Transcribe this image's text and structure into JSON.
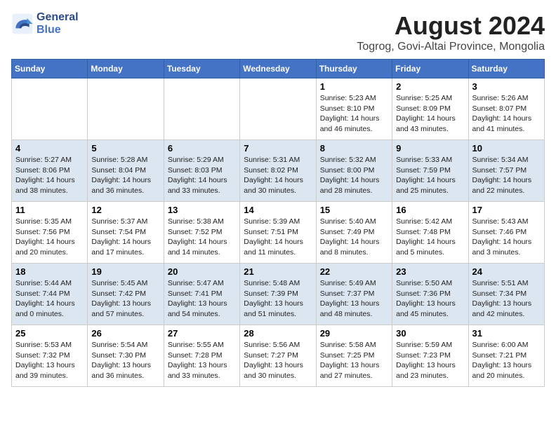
{
  "logo": {
    "line1": "General",
    "line2": "Blue"
  },
  "title": "August 2024",
  "subtitle": "Togrog, Govi-Altai Province, Mongolia",
  "weekdays": [
    "Sunday",
    "Monday",
    "Tuesday",
    "Wednesday",
    "Thursday",
    "Friday",
    "Saturday"
  ],
  "weeks": [
    [
      {
        "day": "",
        "content": ""
      },
      {
        "day": "",
        "content": ""
      },
      {
        "day": "",
        "content": ""
      },
      {
        "day": "",
        "content": ""
      },
      {
        "day": "1",
        "content": "Sunrise: 5:23 AM\nSunset: 8:10 PM\nDaylight: 14 hours\nand 46 minutes."
      },
      {
        "day": "2",
        "content": "Sunrise: 5:25 AM\nSunset: 8:09 PM\nDaylight: 14 hours\nand 43 minutes."
      },
      {
        "day": "3",
        "content": "Sunrise: 5:26 AM\nSunset: 8:07 PM\nDaylight: 14 hours\nand 41 minutes."
      }
    ],
    [
      {
        "day": "4",
        "content": "Sunrise: 5:27 AM\nSunset: 8:06 PM\nDaylight: 14 hours\nand 38 minutes."
      },
      {
        "day": "5",
        "content": "Sunrise: 5:28 AM\nSunset: 8:04 PM\nDaylight: 14 hours\nand 36 minutes."
      },
      {
        "day": "6",
        "content": "Sunrise: 5:29 AM\nSunset: 8:03 PM\nDaylight: 14 hours\nand 33 minutes."
      },
      {
        "day": "7",
        "content": "Sunrise: 5:31 AM\nSunset: 8:02 PM\nDaylight: 14 hours\nand 30 minutes."
      },
      {
        "day": "8",
        "content": "Sunrise: 5:32 AM\nSunset: 8:00 PM\nDaylight: 14 hours\nand 28 minutes."
      },
      {
        "day": "9",
        "content": "Sunrise: 5:33 AM\nSunset: 7:59 PM\nDaylight: 14 hours\nand 25 minutes."
      },
      {
        "day": "10",
        "content": "Sunrise: 5:34 AM\nSunset: 7:57 PM\nDaylight: 14 hours\nand 22 minutes."
      }
    ],
    [
      {
        "day": "11",
        "content": "Sunrise: 5:35 AM\nSunset: 7:56 PM\nDaylight: 14 hours\nand 20 minutes."
      },
      {
        "day": "12",
        "content": "Sunrise: 5:37 AM\nSunset: 7:54 PM\nDaylight: 14 hours\nand 17 minutes."
      },
      {
        "day": "13",
        "content": "Sunrise: 5:38 AM\nSunset: 7:52 PM\nDaylight: 14 hours\nand 14 minutes."
      },
      {
        "day": "14",
        "content": "Sunrise: 5:39 AM\nSunset: 7:51 PM\nDaylight: 14 hours\nand 11 minutes."
      },
      {
        "day": "15",
        "content": "Sunrise: 5:40 AM\nSunset: 7:49 PM\nDaylight: 14 hours\nand 8 minutes."
      },
      {
        "day": "16",
        "content": "Sunrise: 5:42 AM\nSunset: 7:48 PM\nDaylight: 14 hours\nand 5 minutes."
      },
      {
        "day": "17",
        "content": "Sunrise: 5:43 AM\nSunset: 7:46 PM\nDaylight: 14 hours\nand 3 minutes."
      }
    ],
    [
      {
        "day": "18",
        "content": "Sunrise: 5:44 AM\nSunset: 7:44 PM\nDaylight: 14 hours\nand 0 minutes."
      },
      {
        "day": "19",
        "content": "Sunrise: 5:45 AM\nSunset: 7:42 PM\nDaylight: 13 hours\nand 57 minutes."
      },
      {
        "day": "20",
        "content": "Sunrise: 5:47 AM\nSunset: 7:41 PM\nDaylight: 13 hours\nand 54 minutes."
      },
      {
        "day": "21",
        "content": "Sunrise: 5:48 AM\nSunset: 7:39 PM\nDaylight: 13 hours\nand 51 minutes."
      },
      {
        "day": "22",
        "content": "Sunrise: 5:49 AM\nSunset: 7:37 PM\nDaylight: 13 hours\nand 48 minutes."
      },
      {
        "day": "23",
        "content": "Sunrise: 5:50 AM\nSunset: 7:36 PM\nDaylight: 13 hours\nand 45 minutes."
      },
      {
        "day": "24",
        "content": "Sunrise: 5:51 AM\nSunset: 7:34 PM\nDaylight: 13 hours\nand 42 minutes."
      }
    ],
    [
      {
        "day": "25",
        "content": "Sunrise: 5:53 AM\nSunset: 7:32 PM\nDaylight: 13 hours\nand 39 minutes."
      },
      {
        "day": "26",
        "content": "Sunrise: 5:54 AM\nSunset: 7:30 PM\nDaylight: 13 hours\nand 36 minutes."
      },
      {
        "day": "27",
        "content": "Sunrise: 5:55 AM\nSunset: 7:28 PM\nDaylight: 13 hours\nand 33 minutes."
      },
      {
        "day": "28",
        "content": "Sunrise: 5:56 AM\nSunset: 7:27 PM\nDaylight: 13 hours\nand 30 minutes."
      },
      {
        "day": "29",
        "content": "Sunrise: 5:58 AM\nSunset: 7:25 PM\nDaylight: 13 hours\nand 27 minutes."
      },
      {
        "day": "30",
        "content": "Sunrise: 5:59 AM\nSunset: 7:23 PM\nDaylight: 13 hours\nand 23 minutes."
      },
      {
        "day": "31",
        "content": "Sunrise: 6:00 AM\nSunset: 7:21 PM\nDaylight: 13 hours\nand 20 minutes."
      }
    ]
  ]
}
